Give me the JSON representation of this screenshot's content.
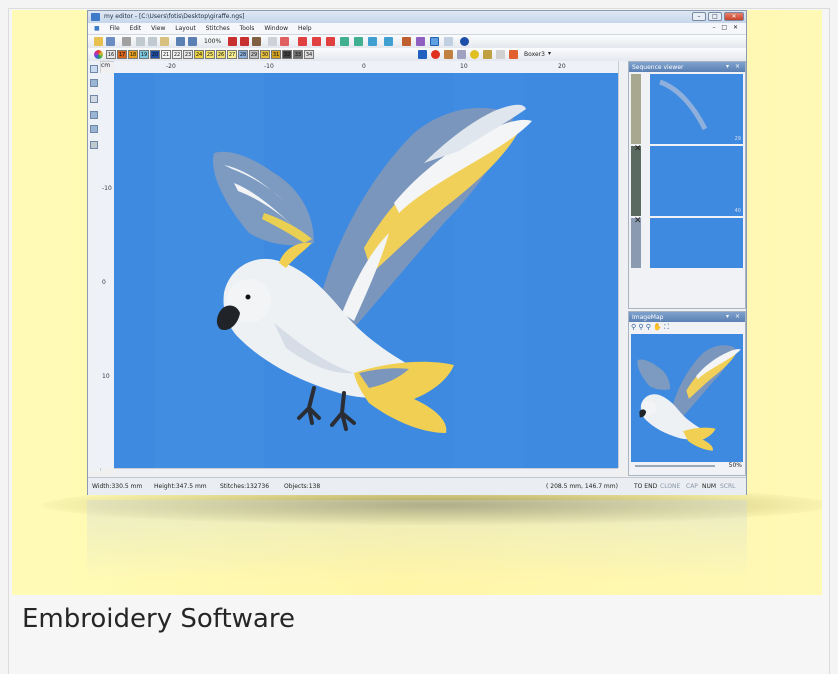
{
  "caption": "Embroidery Software",
  "window": {
    "title": "my editor - [C:\\Users\\fotis\\Desktop\\giraffe.ngs]",
    "controls": [
      "–",
      "□",
      "✕"
    ],
    "mdi_controls": "– □ ✕"
  },
  "menu": [
    "File",
    "Edit",
    "View",
    "Layout",
    "Stitches",
    "Tools",
    "Window",
    "Help"
  ],
  "toolbar": {
    "zoom": "100%"
  },
  "swatches": [
    {
      "label": "16",
      "color": "#e8e8e8"
    },
    {
      "label": "17",
      "color": "#d2641e"
    },
    {
      "label": "18",
      "color": "#e8a020"
    },
    {
      "label": "19",
      "color": "#7bc8e0"
    },
    {
      "label": "20",
      "color": "#1e4fa8"
    },
    {
      "label": "21",
      "color": "#f4f4f4"
    },
    {
      "label": "22",
      "color": "#f0f0f0"
    },
    {
      "label": "23",
      "color": "#e6e6e6"
    },
    {
      "label": "24",
      "color": "#e8d040"
    },
    {
      "label": "25",
      "color": "#f2e26a"
    },
    {
      "label": "26",
      "color": "#f0e070"
    },
    {
      "label": "27",
      "color": "#f6ee90"
    },
    {
      "label": "28",
      "color": "#8ab0e0"
    },
    {
      "label": "29",
      "color": "#c0c0c0"
    },
    {
      "label": "30",
      "color": "#e8c040"
    },
    {
      "label": "31",
      "color": "#d0a020"
    },
    {
      "label": "32",
      "color": "#404040"
    },
    {
      "label": "33",
      "color": "#707070"
    },
    {
      "label": "34",
      "color": "#dcdcdc"
    }
  ],
  "hoop": "Boxer3",
  "ruler": {
    "unit": "cm",
    "h_labels": [
      "-20",
      "-10",
      "0",
      "10",
      "20"
    ],
    "v_labels": [
      "-10",
      "0",
      "10"
    ]
  },
  "sequence_viewer": {
    "title": "Sequence viewer",
    "counts": [
      "29",
      "40"
    ]
  },
  "image_map": {
    "title": "ImageMap",
    "zoom": "50%"
  },
  "status": {
    "width": "Width:330.5 mm",
    "height": "Height:347.5 mm",
    "stitches": "Stitches:132736",
    "objects": "Objects:138",
    "coords": "( 208.5 mm, 146.7 mm)",
    "to_end": "TO END",
    "clone": "CLONE",
    "cap": "CAP",
    "num": "NUM",
    "scrl": "SCRL"
  },
  "colors": {
    "canvas": "#3d8ae0",
    "backdrop": "#fff6a8",
    "panel_header": "#5a80b4"
  }
}
